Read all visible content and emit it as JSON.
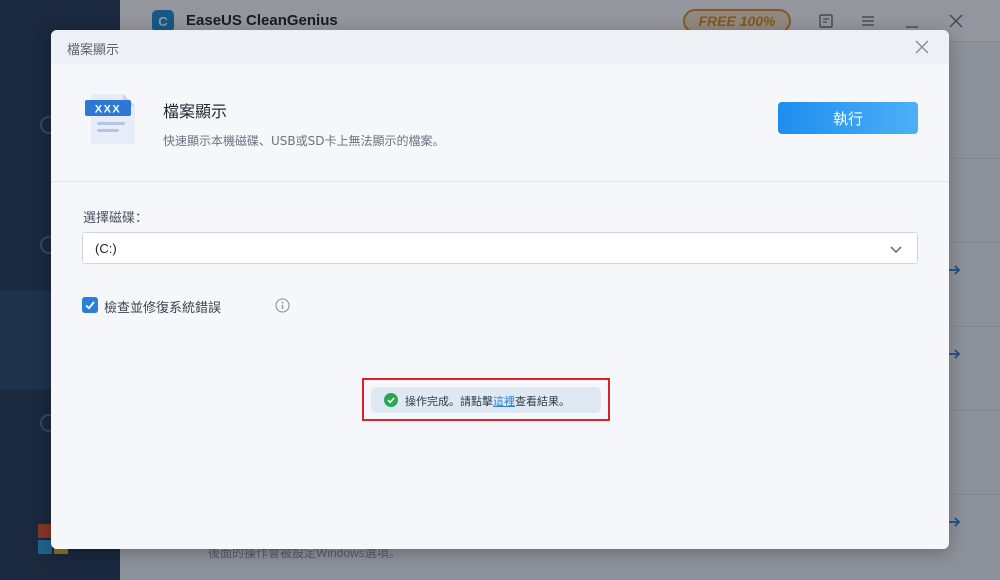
{
  "app": {
    "title": "EaseUS CleanGenius",
    "logo_letter": "C",
    "badge": "FREE 100%",
    "footer_note": "後面的操作會被設定Windows選項。"
  },
  "dialog": {
    "header_title": "檔案顯示",
    "file_icon_text": "XXX",
    "feature_title": "檔案顯示",
    "feature_desc": "快速顯示本機磁碟、USB或SD卡上無法顯示的檔案。",
    "run_button": "執行",
    "drive_label": "選擇磁碟：",
    "drive_value": "(C:)",
    "checkbox_label": "檢查並修復系統錯誤",
    "checkbox_checked": true,
    "toast": {
      "prefix": "操作完成。請點擊",
      "link": "這裡",
      "suffix": "查看結果。"
    }
  },
  "colors": {
    "accent": "#2a7fd9",
    "run_button": "#1e8df0",
    "success": "#2aa84f",
    "highlight_border": "#d9232b",
    "badge": "#e58f2a"
  },
  "icons": [
    "file-display-icon",
    "close-icon",
    "chevron-down-icon",
    "checkmark-icon",
    "info-icon",
    "success-icon"
  ]
}
